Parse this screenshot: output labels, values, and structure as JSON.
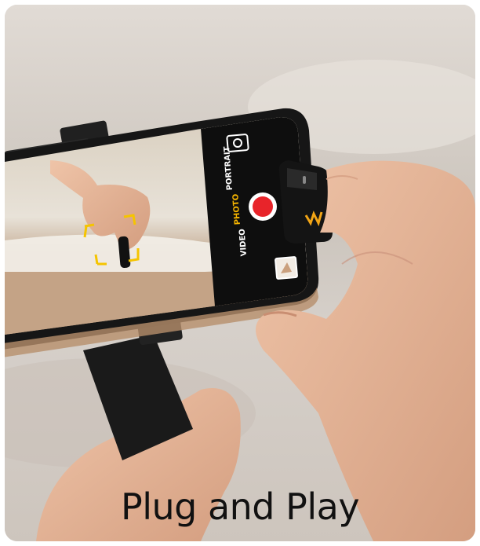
{
  "caption": {
    "text": "Plug and Play"
  },
  "camera_ui": {
    "modes": [
      {
        "label": "PORTRAIT",
        "active": false
      },
      {
        "label": "PHOTO",
        "active": true
      },
      {
        "label": "VIDEO",
        "active": false
      }
    ],
    "active_mode_color": "#f5b400",
    "shutter_color": "#e8242a"
  },
  "device": {
    "logo": "W",
    "accent_color": "#f2a516"
  },
  "colors": {
    "background": "#d6d0ca",
    "phone_body": "#161616",
    "skin": "#e6b59a",
    "sand": "#c8a98a",
    "mount": "#1a1a1a",
    "focus_bracket": "#f5c400"
  }
}
